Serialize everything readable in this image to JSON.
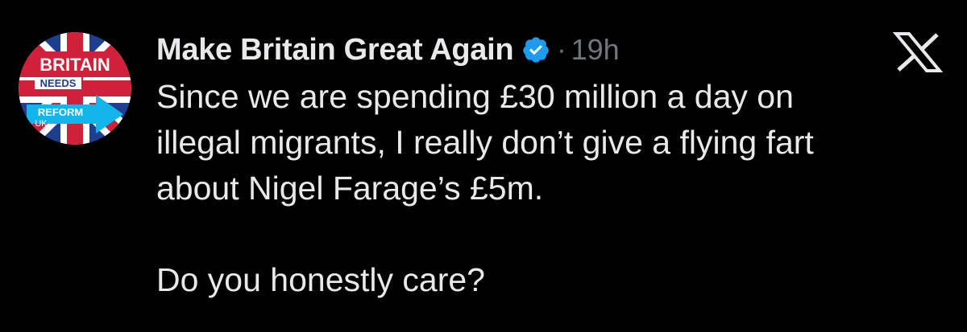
{
  "tweet": {
    "display_name": "Make Britain Great Again",
    "separator": "·",
    "timestamp": "19h",
    "lines": [
      "Since we are spending £30 million a day on",
      "illegal migrants, I really don’t give a flying fart",
      "about Nigel Farage’s £5m.",
      "Do you honestly care?"
    ],
    "avatar_text": {
      "top": "BRITAIN",
      "middle": "NEEDS",
      "arrow": "REFORM",
      "arrow_sub": "UK"
    },
    "verified_icon": "verified-badge-icon",
    "platform_icon": "x-logo-icon"
  },
  "colors": {
    "background": "#000000",
    "text": "#e7e9ea",
    "secondary": "#71767b",
    "verified": "#1d9bf0",
    "avatar_red": "#d1213a",
    "avatar_blue": "#1e3f8f",
    "arrow_blue": "#12b5ea"
  }
}
